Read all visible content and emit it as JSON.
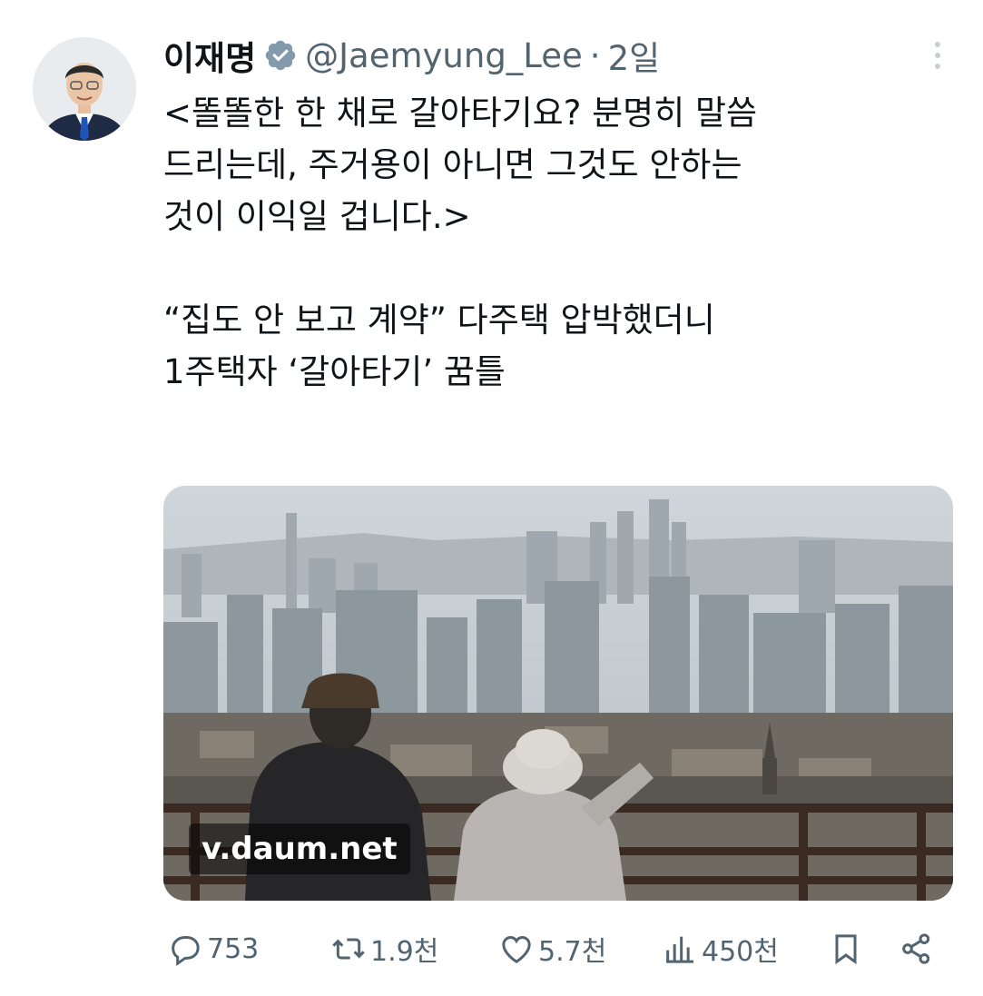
{
  "author": {
    "name": "이재명",
    "handle": "@Jaemyung_Lee",
    "separator": "·",
    "time": "2일",
    "verified_icon": "verified-badge-icon"
  },
  "tweet": {
    "text": "<똘똘한 한 채로 갈아타기요? 분명히 말씀\n드리는데, 주거용이 아니면 그것도 안하는\n것이 이익일 겁니다.>\n\n“집도 안 보고 계약” 다주택 압박했더니\n1주택자 ‘갈아타기’ 꿈틀"
  },
  "card": {
    "domain": "v.daum.net"
  },
  "actions": {
    "replies": "753",
    "retweets": "1.9천",
    "likes": "5.7천",
    "views": "450천"
  },
  "colors": {
    "text": "#0f1419",
    "muted": "#536471",
    "verified": "#829aab"
  }
}
